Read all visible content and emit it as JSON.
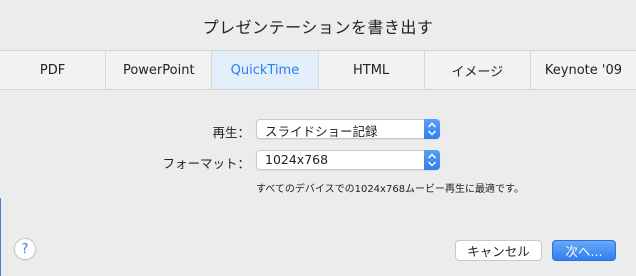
{
  "dialog": {
    "title": "プレゼンテーションを書き出す"
  },
  "tabs": [
    {
      "label": "PDF"
    },
    {
      "label": "PowerPoint"
    },
    {
      "label": "QuickTime",
      "selected": true
    },
    {
      "label": "HTML"
    },
    {
      "label": "イメージ"
    },
    {
      "label": "Keynote '09"
    }
  ],
  "options": {
    "playback_label": "再生：",
    "playback_value": "スライドショー記録",
    "format_label": "フォーマット：",
    "format_value": "1024x768",
    "format_note": "すべてのデバイスでの1024x768ムービー再生に最適です。"
  },
  "footer": {
    "help_icon": "?",
    "cancel_label": "キャンセル",
    "next_label": "次へ..."
  },
  "colors": {
    "accent": "#2f7ff0",
    "selected_tab_bg": "#e3eefb"
  }
}
